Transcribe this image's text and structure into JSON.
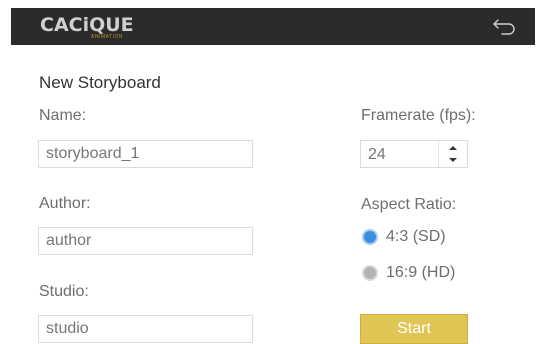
{
  "header": {
    "logo_text": "CACiQUE",
    "logo_subtext": "ANIMATION",
    "back_icon": "back-arrow-icon"
  },
  "form": {
    "title": "New Storyboard",
    "name": {
      "label": "Name:",
      "value": "storyboard_1"
    },
    "author": {
      "label": "Author:",
      "value": "author"
    },
    "studio": {
      "label": "Studio:",
      "value": "studio"
    },
    "framerate": {
      "label": "Framerate (fps):",
      "value": "24"
    },
    "aspect_ratio": {
      "label": "Aspect Ratio:",
      "options": [
        {
          "label": "4:3 (SD)",
          "selected": true
        },
        {
          "label": "16:9 (HD)",
          "selected": false
        }
      ]
    },
    "start_label": "Start"
  },
  "colors": {
    "topbar": "#2b2b2b",
    "accent_radio": "#3e8edf",
    "start_button": "#e0c454",
    "logo_sub": "#b8902e"
  }
}
